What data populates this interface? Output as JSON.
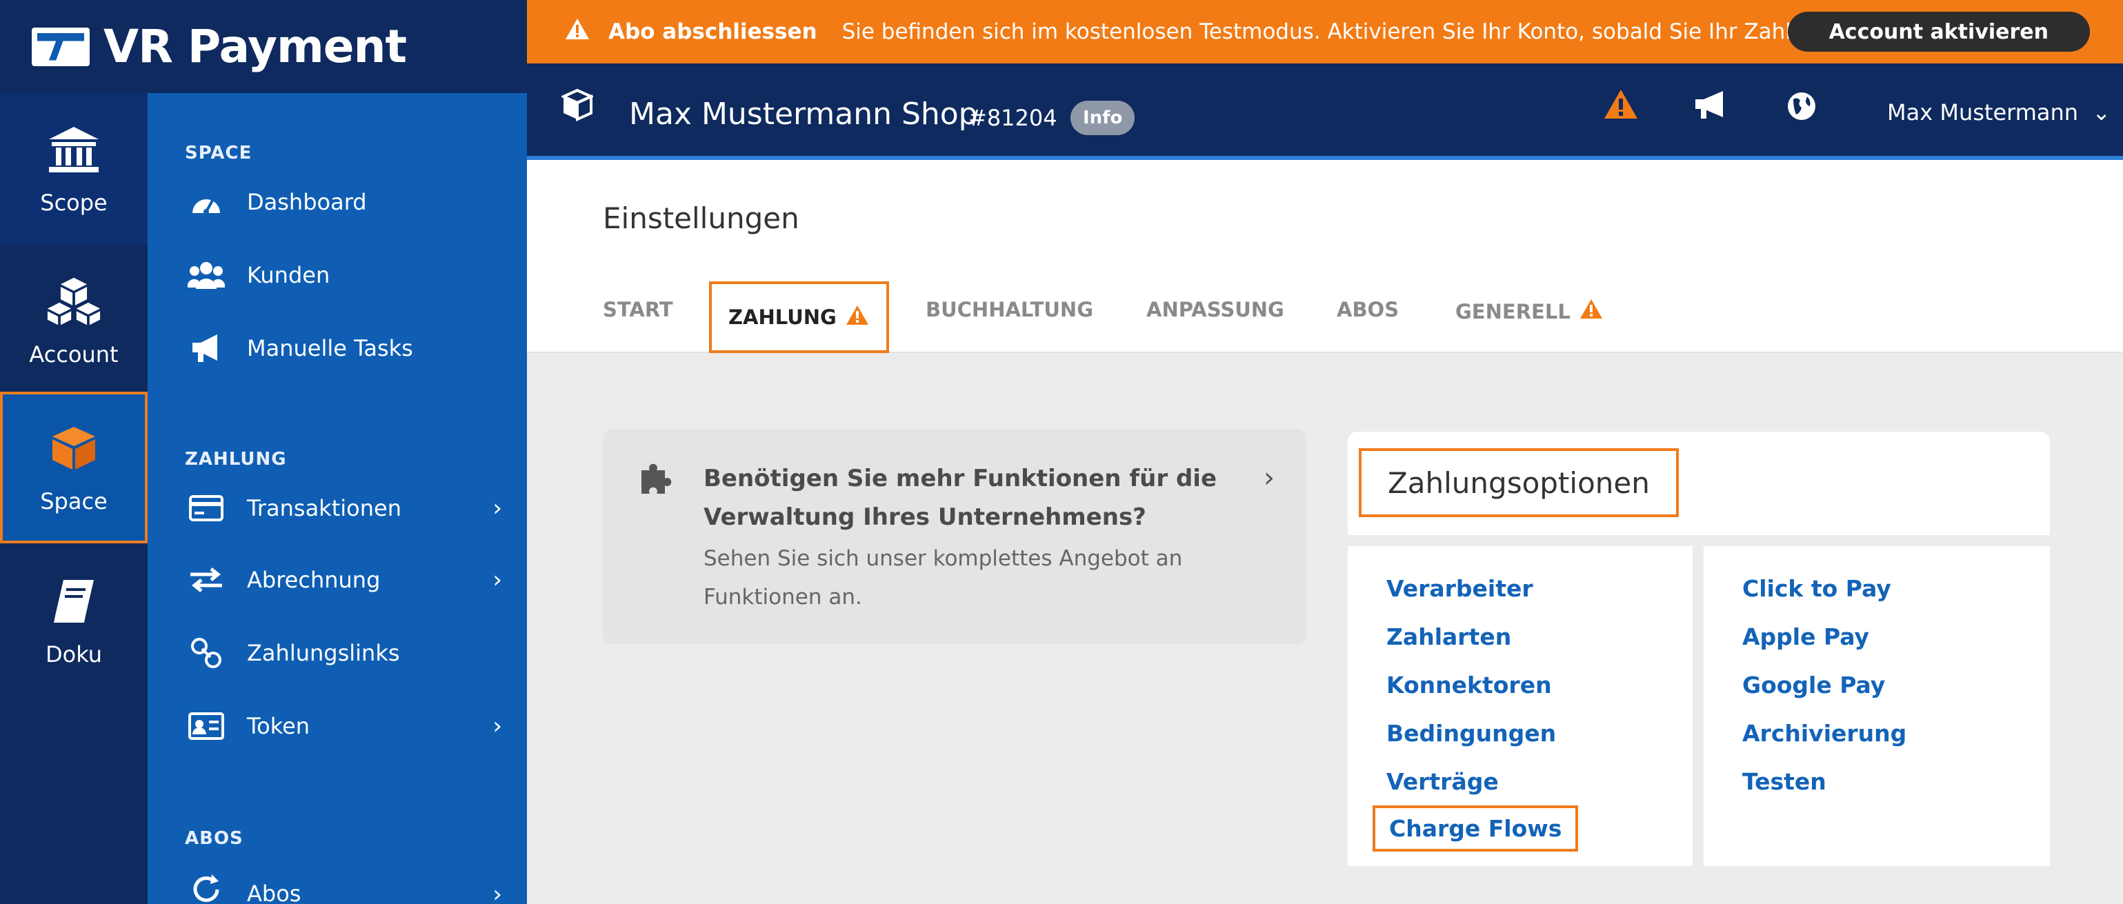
{
  "brand": {
    "name": "VR Payment"
  },
  "banner": {
    "title": "Abo abschliessen",
    "message": "Sie befinden sich im kostenlosen Testmodus. Aktivieren Sie Ihr Konto, sobald Sie Ihr Zahlun...",
    "button": "Account aktivieren"
  },
  "rail": {
    "scope": "Scope",
    "account": "Account",
    "space": "Space",
    "doku": "Doku"
  },
  "nav": {
    "sections": {
      "space": "SPACE",
      "zahlung": "ZAHLUNG",
      "abos": "ABOS"
    },
    "items": {
      "dashboard": "Dashboard",
      "kunden": "Kunden",
      "manuelle_tasks": "Manuelle Tasks",
      "transaktionen": "Transaktionen",
      "abrechnung": "Abrechnung",
      "zahlungslinks": "Zahlungslinks",
      "token": "Token",
      "abos": "Abos"
    }
  },
  "header": {
    "shop_name": "Max Mustermann Shop",
    "shop_id": "#81204",
    "info_badge": "Info",
    "user": "Max Mustermann"
  },
  "page": {
    "title": "Einstellungen",
    "tabs": {
      "start": "START",
      "zahlung": "ZAHLUNG",
      "buchhaltung": "BUCHHALTUNG",
      "anpassung": "ANPASSUNG",
      "abos": "ABOS",
      "generell": "GENERELL"
    }
  },
  "promo": {
    "heading": "Benötigen Sie mehr Funktionen für die Verwaltung Ihres Unternehmens?",
    "text": "Sehen Sie sich unser komplettes Angebot an Funktionen an."
  },
  "payment_options": {
    "title": "Zahlungsoptionen",
    "col1": {
      "verarbeiter": "Verarbeiter",
      "zahlarten": "Zahlarten",
      "konnektoren": "Konnektoren",
      "bedingungen": "Bedingungen",
      "vertraege": "Verträge",
      "charge_flows": "Charge Flows"
    },
    "col2": {
      "click_to_pay": "Click to Pay",
      "apple_pay": "Apple Pay",
      "google_pay": "Google Pay",
      "archivierung": "Archivierung",
      "testen": "Testen"
    }
  },
  "colors": {
    "rail": "#0e2a5e",
    "nav": "#0f5eb3",
    "banner": "#f27b15",
    "highlight": "#f07b1d",
    "link": "#1363b8"
  }
}
